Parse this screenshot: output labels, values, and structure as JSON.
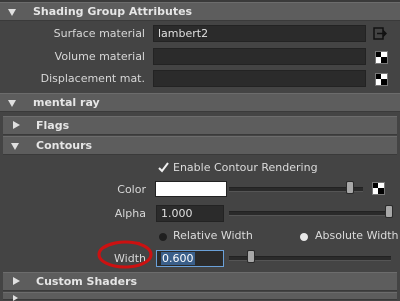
{
  "shading_group": {
    "title": "Shading Group Attributes",
    "surface_material_label": "Surface material",
    "surface_material_value": "lambert2",
    "volume_material_label": "Volume material",
    "volume_material_value": "",
    "displacement_label": "Displacement mat.",
    "displacement_value": ""
  },
  "sections": {
    "mental_ray": "mental ray",
    "flags": "Flags",
    "contours": "Contours",
    "custom_shaders": "Custom Shaders"
  },
  "contours": {
    "enable_label": "Enable Contour Rendering",
    "enable_checked": true,
    "color_label": "Color",
    "color_value": "#ffffff",
    "alpha_label": "Alpha",
    "alpha_value": "1.000",
    "relative_width_label": "Relative Width",
    "absolute_width_label": "Absolute Width",
    "width_mode": "absolute",
    "width_label": "Width",
    "width_value": "0.600",
    "color_slider_level": 0.93,
    "alpha_slider_level": 1.0,
    "width_slider_level": 0.12
  },
  "icons": {
    "connect": "map-connect-icon",
    "checker": "checker-texture-icon"
  },
  "colors": {
    "annotation_circle": "#cc1111",
    "header_bg": "#5d5d5d",
    "panel_bg": "#444444",
    "highlight_field": "#3a5f8a"
  }
}
